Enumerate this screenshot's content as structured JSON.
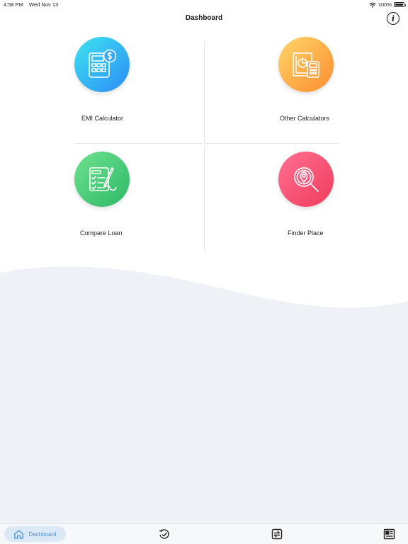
{
  "status": {
    "time": "4:58 PM",
    "date": "Wed Nov 13",
    "battery": "100%",
    "wifi_icon": "wifi-icon"
  },
  "header": {
    "title": "Dashboard",
    "info_icon": "info-icon",
    "info_glyph": "i"
  },
  "tiles": [
    {
      "label": "EMI Calculator",
      "icon": "calculator-dollar-icon",
      "gradient": [
        "#3de3f0",
        "#2d8cf5"
      ]
    },
    {
      "label": "Other Calculators",
      "icon": "calculator-chart-icon",
      "gradient": [
        "#ffd66a",
        "#fb8c2e"
      ]
    },
    {
      "label": "Compare Loan",
      "icon": "clipboard-checklist-icon",
      "gradient": [
        "#6fe28e",
        "#2cb867"
      ]
    },
    {
      "label": "Finder Place",
      "icon": "search-location-icon",
      "gradient": [
        "#ff7292",
        "#f03a5c"
      ]
    }
  ],
  "tabbar": {
    "dashboard_label": "Dashboard",
    "items": [
      "home-icon",
      "history-icon",
      "exchange-icon",
      "news-icon"
    ],
    "active_color": "#4b90d9"
  },
  "colors": {
    "background_wave": "#eef2f7",
    "divider": "#e3e6ea"
  }
}
